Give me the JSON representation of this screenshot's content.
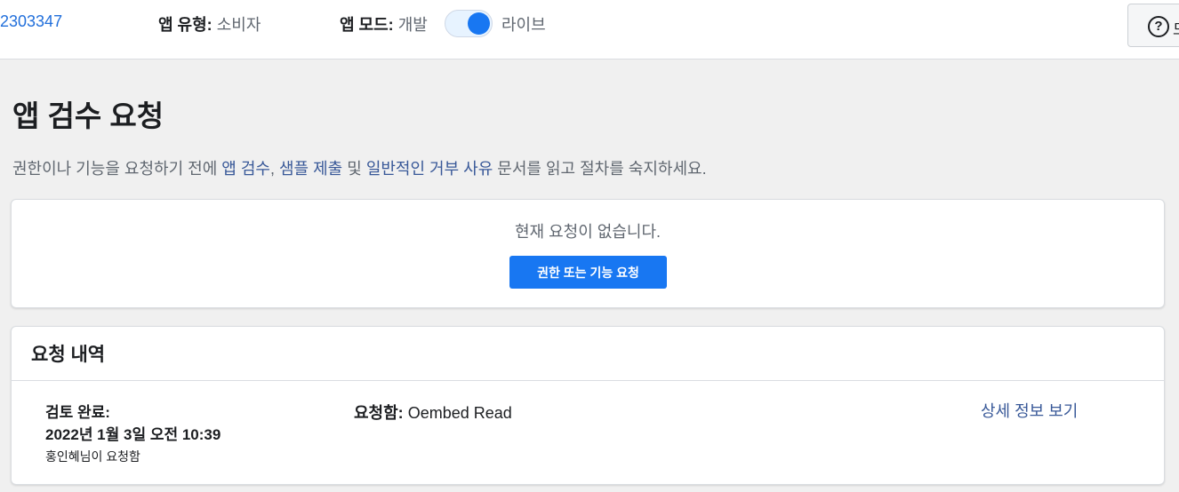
{
  "topbar": {
    "app_id": "2303347",
    "app_type_label": "앱 유형:",
    "app_type_value": "소비자",
    "app_mode_label": "앱 모드:",
    "app_mode_dev": "개발",
    "app_mode_live": "라이브",
    "toggle_on": true,
    "help_text": "도"
  },
  "page": {
    "title": "앱 검수 요청",
    "intro": {
      "prefix": "권한이나 기능을 요청하기 전에 ",
      "link1": "앱 검수",
      "sep1": ", ",
      "link2": "샘플 제출",
      "sep2": " 및 ",
      "link3": "일반적인 거부 사유",
      "suffix": " 문서를 읽고 절차를 숙지하세요."
    }
  },
  "current_requests": {
    "empty_text": "현재 요청이 없습니다.",
    "button_label": "권한 또는 기능 요청"
  },
  "history": {
    "title": "요청 내역",
    "items": [
      {
        "status": "검토 완료:",
        "date": "2022년 1월 3일 오전 10:39",
        "requester": "홍인혜님이 요청함",
        "requested_label": "요청함:",
        "requested_value": " Oembed Read",
        "detail_link": "상세 정보 보기"
      }
    ]
  },
  "colors": {
    "primary": "#1877f2",
    "link": "#385898",
    "app_id": "#216fdb"
  }
}
